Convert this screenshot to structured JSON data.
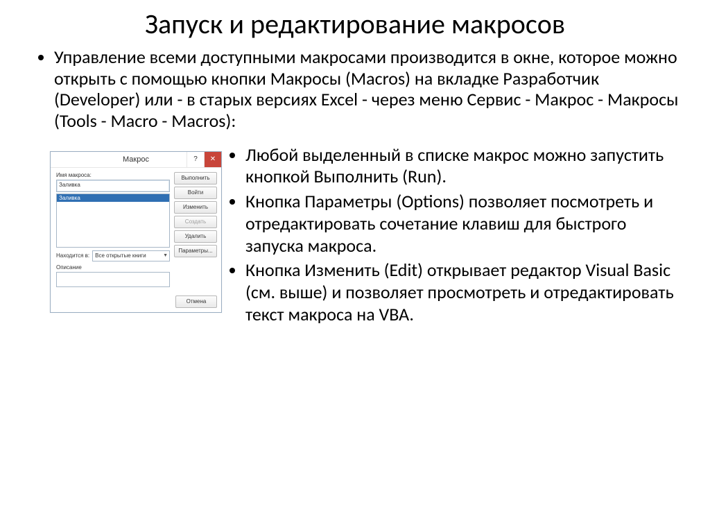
{
  "title": "Запуск и редактирование макросов",
  "intro": "Управление всеми доступными макросами производится в окне, которое можно открыть с помощью кнопки Макросы (Macros) на вкладке Разработчик (Developer) или - в старых версиях Excel - через меню Сервис - Макрос - Макросы (Tools - Macro - Macros):",
  "bullets": [
    "Любой выделенный в списке макрос можно запустить кнопкой Выполнить (Run).",
    "Кнопка Параметры (Options) позволяет посмотреть и отредактировать сочетание клавиш для быстрого запуска макроса.",
    "Кнопка Изменить (Edit) открывает редактор Visual Basic (см. выше) и позволяет просмотреть и отредактировать текст макроса на VBA."
  ],
  "dialog": {
    "title": "Макрос",
    "help_glyph": "?",
    "close_glyph": "✕",
    "name_label": "Имя макроса:",
    "name_value": "Заливка",
    "selected_item": "Заливка",
    "buttons": {
      "run": "Выполнить",
      "step": "Войти",
      "edit": "Изменить",
      "create": "Создать",
      "delete": "Удалить",
      "options": "Параметры..."
    },
    "located_label": "Находится в:",
    "located_value": "Все открытые книги",
    "description_label": "Описание",
    "cancel": "Отмена"
  }
}
